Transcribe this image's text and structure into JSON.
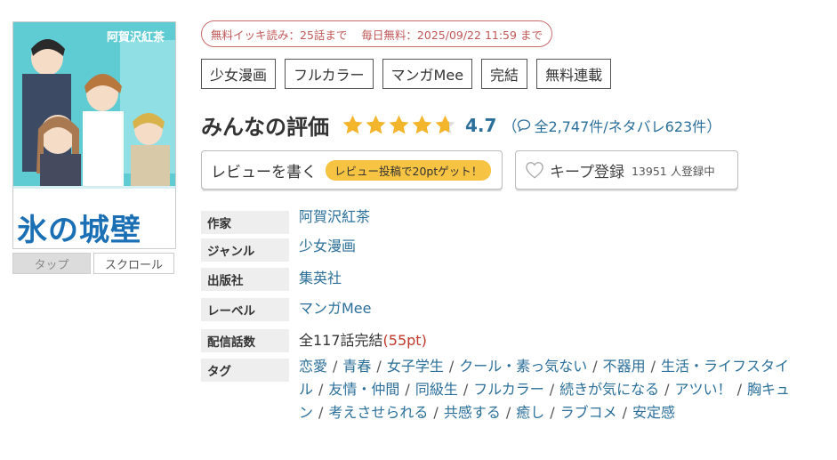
{
  "cover": {
    "author_overlay": "阿賀沢紅茶",
    "logo_text": "氷の城壁",
    "colors": {
      "background": "#5fcbd3",
      "logo": "#1b6fb5"
    }
  },
  "view_buttons": {
    "tap": "タップ",
    "scroll": "スクロール"
  },
  "free_info": {
    "ikki": "無料イッキ読み：25話まで",
    "daily": "毎日無料：2025/09/22 11:59 まで"
  },
  "genre_tags": [
    "少女漫画",
    "フルカラー",
    "マンガMee",
    "完結",
    "無料連載"
  ],
  "rating": {
    "title": "みんなの評価",
    "stars": 4.7,
    "score": "4.7",
    "open_paren": "（",
    "counts": "全2,747件/ネタバレ623件",
    "close_paren": "）",
    "colors": {
      "star": "#f2b52b",
      "score": "#2b6f9a"
    }
  },
  "review": {
    "label": "レビューを書く",
    "badge": "レビュー投稿で20ptゲット！"
  },
  "keep": {
    "label": "キープ登録",
    "count": "13951 人登録中",
    "icon": "heart-icon"
  },
  "info": {
    "author_label": "作家",
    "author": "阿賀沢紅茶",
    "genre_label": "ジャンル",
    "genre": "少女漫画",
    "publisher_label": "出版社",
    "publisher": "集英社",
    "label_label": "レーベル",
    "label": "マンガMee",
    "episodes_label": "配信話数",
    "episodes": "全117話完結",
    "price": "(55pt)",
    "tags_label": "タグ",
    "tags": [
      "恋愛",
      "青春",
      "女子学生",
      "クール・素っ気ない",
      "不器用",
      "生活・ライフスタイル",
      "友情・仲間",
      "同級生",
      "フルカラー",
      "続きが気になる",
      "アツい！",
      "胸キュン",
      "考えさせられる",
      "共感する",
      "癒し",
      "ラブコメ",
      "安定感"
    ]
  }
}
